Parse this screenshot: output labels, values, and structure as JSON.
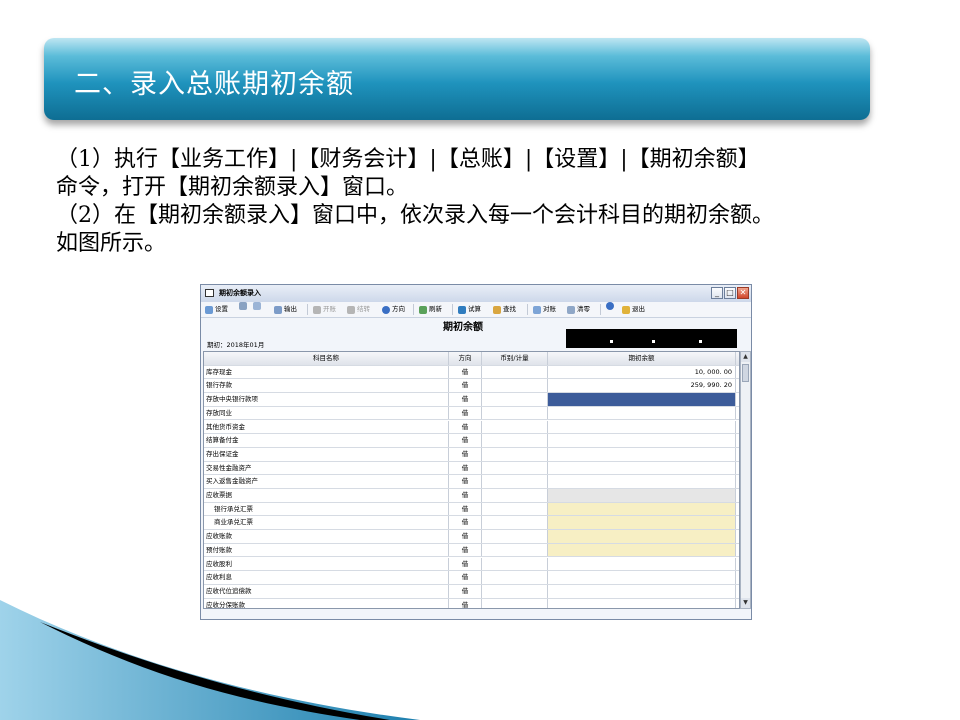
{
  "slide": {
    "title": "二、录入总账期初余额",
    "para1_line1": "（1）执行【业务工作】|【财务会计】|【总账】|【设置】|【期初余额】",
    "para1_line2": "命令，打开【期初余额录入】窗口。",
    "para2_line1": "（2）在【期初余额录入】窗口中，依次录入每一个会计科目的期初余额。",
    "para2_line2": "如图所示。"
  },
  "window": {
    "title": "期初余额录入",
    "controls": {
      "minimize": "_",
      "maximize": "□",
      "close": "✕"
    },
    "toolbar": {
      "setup": "设置",
      "output": "输出",
      "open_account": "开账",
      "close_account": "结转",
      "direction": "方向",
      "refresh": "刷新",
      "trial": "试算",
      "find": "查找",
      "reconcile": "对账",
      "clear": "清零",
      "exit": "退出"
    },
    "report_title": "期初余额",
    "period": "期初：2018年01月",
    "columns": [
      "科目名称",
      "方向",
      "币别/计量",
      "期初余额"
    ],
    "rows": [
      {
        "name": "库存现金",
        "dir": "借",
        "unit": "",
        "balance": "10, 000. 00",
        "style": "white"
      },
      {
        "name": "银行存款",
        "dir": "借",
        "unit": "",
        "balance": "259, 990. 20",
        "style": "white"
      },
      {
        "name": "存放中央银行款项",
        "dir": "借",
        "unit": "",
        "balance": "",
        "style": "selected"
      },
      {
        "name": "存放同业",
        "dir": "借",
        "unit": "",
        "balance": "",
        "style": "white"
      },
      {
        "name": "其他货币资金",
        "dir": "借",
        "unit": "",
        "balance": "",
        "style": "white"
      },
      {
        "name": "结算备付金",
        "dir": "借",
        "unit": "",
        "balance": "",
        "style": "white"
      },
      {
        "name": "存出保证金",
        "dir": "借",
        "unit": "",
        "balance": "",
        "style": "white"
      },
      {
        "name": "交易性金融资产",
        "dir": "借",
        "unit": "",
        "balance": "",
        "style": "white"
      },
      {
        "name": "买入返售金融资产",
        "dir": "借",
        "unit": "",
        "balance": "",
        "style": "white"
      },
      {
        "name": "应收票据",
        "dir": "借",
        "unit": "",
        "balance": "",
        "style": "gray"
      },
      {
        "name": "银行承兑汇票",
        "dir": "借",
        "unit": "",
        "balance": "",
        "style": "yellow",
        "indent": true
      },
      {
        "name": "商业承兑汇票",
        "dir": "借",
        "unit": "",
        "balance": "",
        "style": "yellow",
        "indent": true
      },
      {
        "name": "应收账款",
        "dir": "借",
        "unit": "",
        "balance": "",
        "style": "yellow"
      },
      {
        "name": "预付账款",
        "dir": "借",
        "unit": "",
        "balance": "",
        "style": "yellow"
      },
      {
        "name": "应收股利",
        "dir": "借",
        "unit": "",
        "balance": "",
        "style": "white"
      },
      {
        "name": "应收利息",
        "dir": "借",
        "unit": "",
        "balance": "",
        "style": "white"
      },
      {
        "name": "应收代位追偿款",
        "dir": "借",
        "unit": "",
        "balance": "",
        "style": "white"
      },
      {
        "name": "应收分保账款",
        "dir": "借",
        "unit": "",
        "balance": "",
        "style": "white"
      }
    ],
    "colors": {
      "selected": "#3d5c9a",
      "gray": "#e6e6e6",
      "yellow": "#f7efc4"
    }
  }
}
